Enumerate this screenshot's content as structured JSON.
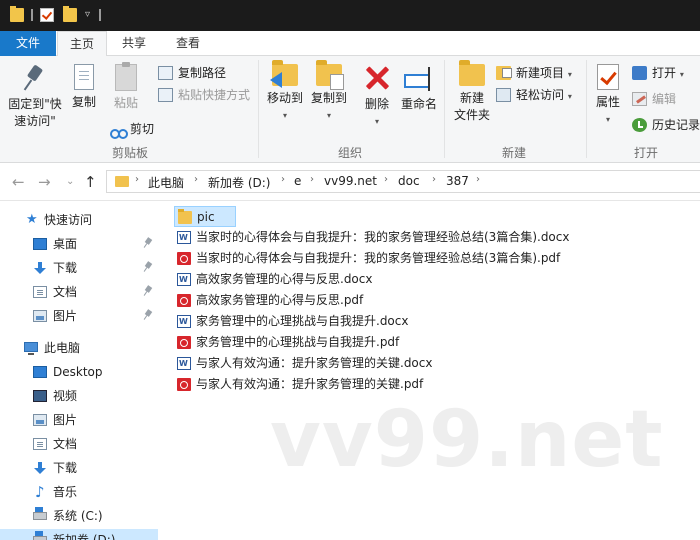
{
  "ribbon": {
    "tabs": {
      "file": "文件",
      "home": "主页",
      "share": "共享",
      "view": "查看"
    },
    "clipboard": {
      "pin_line1": "固定到\"快",
      "pin_line2": "速访问\"",
      "copy": "复制",
      "paste": "粘贴",
      "copy_path": "复制路径",
      "paste_shortcut": "粘贴快捷方式",
      "cut": "剪切",
      "group_label": "剪贴板"
    },
    "organize": {
      "move_to": "移动到",
      "copy_to": "复制到",
      "delete": "删除",
      "rename": "重命名",
      "group_label": "组织"
    },
    "new": {
      "new_folder_line1": "新建",
      "new_folder_line2": "文件夹",
      "new_item": "新建项目",
      "easy_access": "轻松访问",
      "group_label": "新建"
    },
    "open": {
      "properties": "属性",
      "open": "打开",
      "edit": "编辑",
      "history": "历史记录",
      "group_label": "打开"
    }
  },
  "address": {
    "crumbs": [
      "此电脑",
      "新加卷 (D:)",
      "e",
      "vv99.net",
      "doc",
      "387"
    ]
  },
  "nav": {
    "quick_access": "快速访问",
    "quick_items": [
      "桌面",
      "下载",
      "文档",
      "图片"
    ],
    "this_pc": "此电脑",
    "pc_items": [
      "Desktop",
      "视频",
      "图片",
      "文档",
      "下载",
      "音乐",
      "系统 (C:)",
      "新加卷 (D:)"
    ]
  },
  "files": [
    {
      "name": "pic",
      "type": "folder"
    },
    {
      "name": "当家时的心得体会与自我提升：我的家务管理经验总结(3篇合集).docx",
      "type": "word"
    },
    {
      "name": "当家时的心得体会与自我提升：我的家务管理经验总结(3篇合集).pdf",
      "type": "pdf"
    },
    {
      "name": "高效家务管理的心得与反思.docx",
      "type": "word"
    },
    {
      "name": "高效家务管理的心得与反思.pdf",
      "type": "pdf"
    },
    {
      "name": "家务管理中的心理挑战与自我提升.docx",
      "type": "word"
    },
    {
      "name": "家务管理中的心理挑战与自我提升.pdf",
      "type": "pdf"
    },
    {
      "name": "与家人有效沟通：提升家务管理的关键.docx",
      "type": "word"
    },
    {
      "name": "与家人有效沟通：提升家务管理的关键.pdf",
      "type": "pdf"
    }
  ],
  "watermark": "vv99.net",
  "colors": {
    "accent": "#1979ca",
    "folder": "#f1c24e",
    "selection": "#cce8ff",
    "pdf": "#d7262c",
    "word": "#2b579a"
  }
}
